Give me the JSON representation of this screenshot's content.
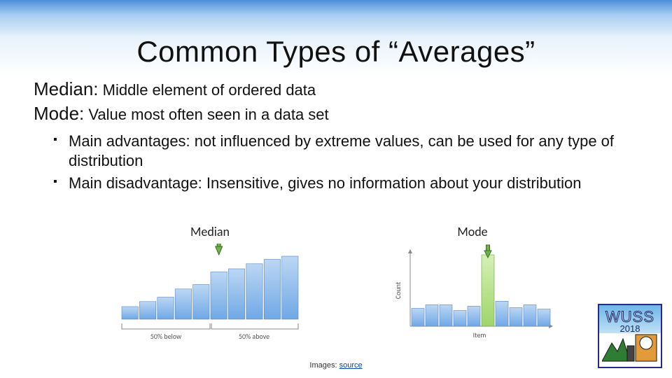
{
  "title": "Common Types of “Averages”",
  "defs": {
    "median": {
      "term": "Median:",
      "desc": "Middle element of ordered data"
    },
    "mode": {
      "term": "Mode:",
      "desc": "Value most often seen in a data set"
    }
  },
  "bullets": [
    "Main advantages: not influenced by extreme values, can be used for any type of distribution",
    "Main disadvantage: Insensitive, gives no information about your distribution"
  ],
  "chart_data": [
    {
      "type": "bar",
      "title": "Median",
      "values": [
        20,
        28,
        35,
        48,
        55,
        75,
        80,
        88,
        95,
        100
      ],
      "median_index": 5,
      "annotations": {
        "below": "50% below",
        "above": "50% above"
      },
      "ylim": [
        0,
        100
      ]
    },
    {
      "type": "bar",
      "title": "Mode",
      "values": [
        25,
        30,
        30,
        22,
        28,
        100,
        35,
        26,
        30,
        24
      ],
      "mode_index": 5,
      "xlabel": "Item",
      "ylabel": "Count",
      "ylim": [
        0,
        100
      ]
    }
  ],
  "caption": {
    "prefix": "Images: ",
    "link_text": "source"
  },
  "logo": {
    "title": "WUSS",
    "year": "2018"
  }
}
